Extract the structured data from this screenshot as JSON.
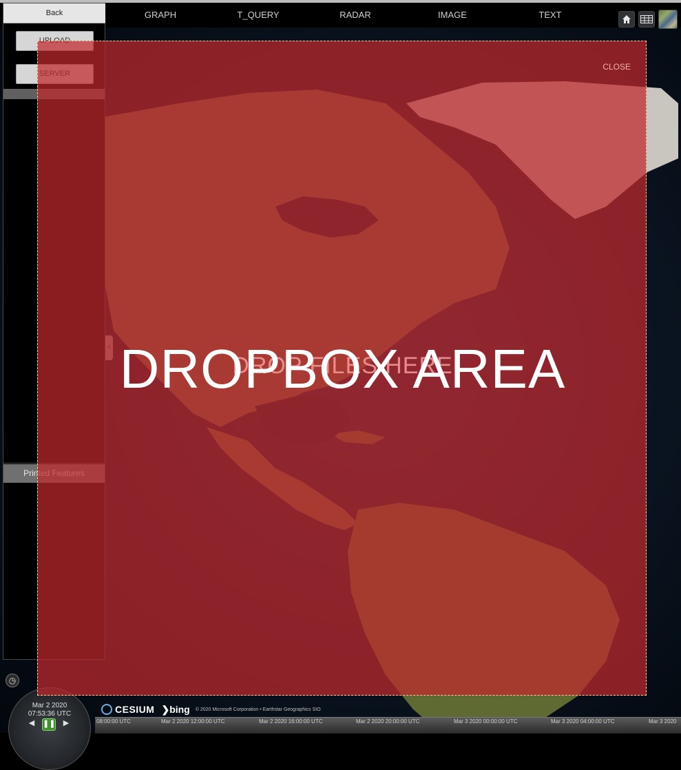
{
  "nav": {
    "back": "Back",
    "items": [
      "GRAPH",
      "T_QUERY",
      "RADAR",
      "IMAGE",
      "TEXT"
    ]
  },
  "toolbar": {
    "home_icon": "home-icon",
    "projection_icon": "grid-projection-icon",
    "layers_icon": "imagery-layer-icon"
  },
  "sidebar": {
    "upload_label": "UPLOAD",
    "server_label": "SERVER",
    "printed_features_label": "Printed Features",
    "collapse_label": "<"
  },
  "overlay": {
    "title": "DROPBOX AREA",
    "hint": "DROP FILES HERE",
    "close_label": "CLOSE",
    "color": "#c0282e"
  },
  "animation": {
    "date": "Mar 2 2020",
    "time": "07:53:36 UTC"
  },
  "credits": {
    "cesium": "CESIUM",
    "bing": "bing",
    "text": "© 2020 Microsoft Corporation • Earthstar Geographics SIO"
  },
  "timeline": {
    "ticks": [
      "08:00:00 UTC",
      "Mar 2 2020 12:00:00 UTC",
      "Mar 2 2020 16:00:00 UTC",
      "Mar 2 2020 20:00:00 UTC",
      "Mar 3 2020 00:00:00 UTC",
      "Mar 3 2020 04:00:00 UTC",
      "Mar 3 2020"
    ]
  }
}
